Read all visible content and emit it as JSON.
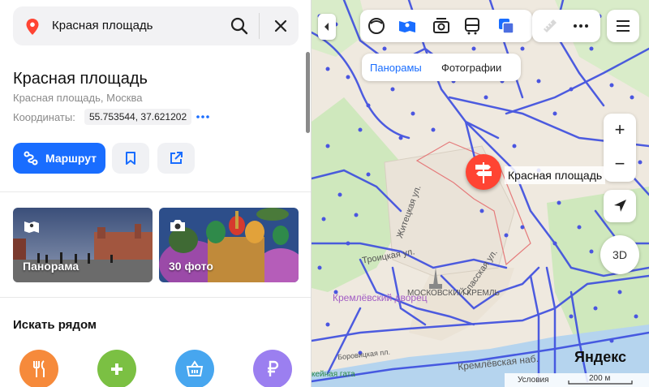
{
  "search": {
    "query": "Красная площадь"
  },
  "place": {
    "title": "Красная площадь",
    "address": "Красная площадь, Москва",
    "coords_label": "Координаты:",
    "coords_value": "55.753544, 37.621202"
  },
  "actions": {
    "route_label": "Маршрут"
  },
  "media": [
    {
      "label": "Панорама"
    },
    {
      "label": "30 фото"
    }
  ],
  "nearby": {
    "title": "Искать рядом",
    "categories": [
      {
        "name": "restaurants",
        "color": "#f68a3b"
      },
      {
        "name": "pharmacy",
        "color": "#7bc043"
      },
      {
        "name": "shops",
        "color": "#47a6ef"
      },
      {
        "name": "atm",
        "color": "#9b7ff0"
      }
    ]
  },
  "map": {
    "layers": {
      "panoramas": "Панорамы",
      "photos": "Фотографии"
    },
    "pin_label": "Красная площадь",
    "labels": {
      "kremlin": "МОСКОВСКИЙ КРЕМЛЬ",
      "palace": "Кремлёвский дворец",
      "troitskaya": "Троицкая ул.",
      "spasskaya": "Спасская ул.",
      "zhitetskaya": "Житецкая ул.",
      "embankment": "Кремлёвская наб.",
      "borovitskaya": "Боровицкая пл.",
      "park": "кейная гата"
    },
    "zoom_in": "+",
    "zoom_out": "−",
    "btn_3d": "3D",
    "brand": "Яндекс",
    "terms": "Условия",
    "scale": "200 м"
  },
  "colors": {
    "accent": "#196dff",
    "pin": "#ff4433",
    "route": "#3b4cdf"
  }
}
